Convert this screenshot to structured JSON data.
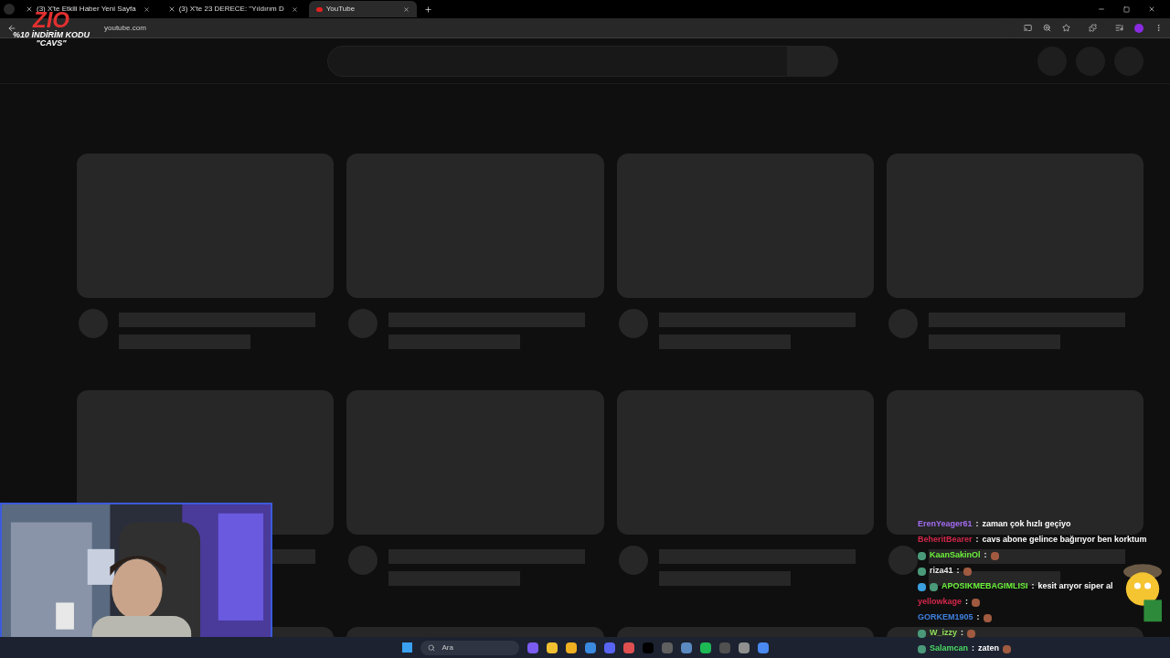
{
  "tabs": [
    {
      "title": "(3) X'te Etkili Haber Yeni Sayfa",
      "selected": false,
      "kind": "x"
    },
    {
      "title": "(3) X'te 23 DERECE: \"Yıldırım D",
      "selected": false,
      "kind": "x"
    },
    {
      "title": "YouTube",
      "selected": true,
      "kind": "youtube"
    }
  ],
  "address_bar": {
    "url": "youtube.com"
  },
  "stream_overlay": {
    "logo": "ZIO",
    "promo_line": "%10 İNDİRİM KODU",
    "promo_code": "\"CAVS\""
  },
  "chat": [
    {
      "user": "ErenYeager61",
      "color": "#a46cf2",
      "separator": ":",
      "text": "zaman çok hızlı geçiyo",
      "emote": false
    },
    {
      "user": "BeheritBearer",
      "color": "#d5274b",
      "separator": ":",
      "text": "cavs abone gelince bağırıyor ben korktum",
      "emote": false
    },
    {
      "user": "KaanSakinOl",
      "color": "#6cf23a",
      "badges": [
        {
          "kind": "sub"
        }
      ],
      "separator": ":",
      "emote": true
    },
    {
      "user": "riza41",
      "color": "#e8e8e8",
      "badges": [
        {
          "kind": "sub"
        }
      ],
      "separator": ":",
      "emote": true
    },
    {
      "user": "APOSIKMEBAGIMLISI",
      "color": "#6cf23a",
      "badges": [
        {
          "kind": "cube"
        },
        {
          "kind": "sub"
        }
      ],
      "separator": ":",
      "text": "kesit arıyor siper al",
      "emote": false
    },
    {
      "user": "yellowkage",
      "color": "#d5274b",
      "separator": ":",
      "emote": true
    },
    {
      "user": "GORKEM1905",
      "color": "#3f80e0",
      "separator": ":",
      "emote": true
    },
    {
      "user": "W_izzy",
      "color": "#8fe05a",
      "badges": [
        {
          "kind": "sub"
        }
      ],
      "separator": ":",
      "emote": true
    },
    {
      "user": "Salamcan",
      "color": "#4cd964",
      "badges": [
        {
          "kind": "sub"
        }
      ],
      "separator": ":",
      "text": "zaten",
      "emote": true
    }
  ],
  "taskbar": {
    "search_placeholder": "Ara"
  }
}
